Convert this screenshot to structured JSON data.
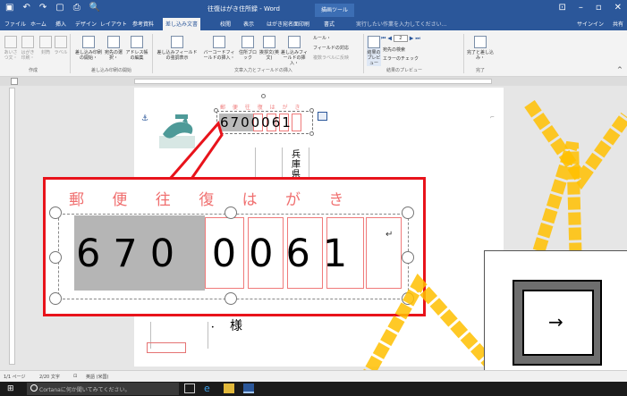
{
  "titlebar": {
    "save_icon": "save-icon",
    "undo_icon": "undo-icon",
    "redo_icon": "redo-icon",
    "new_icon": "new-document-icon",
    "print_preview_icon": "print-preview-icon",
    "title": "往復はがき住所録 - Word",
    "context_tab": "描画ツール",
    "minimize": "–",
    "maximize": "▫",
    "close": "✕",
    "restore": "⊡"
  },
  "tabs": {
    "items": [
      "ファイル",
      "ホーム",
      "挿入",
      "デザイン",
      "レイアウト",
      "参考資料",
      "差し込み文書",
      "校閲",
      "表示",
      "はがき宛名面印刷",
      "書式"
    ],
    "active_index": 6,
    "tell_me": "実行したい作業を入力してください...",
    "sign_in": "サインイン",
    "share": "共有"
  },
  "ribbon": {
    "create": {
      "group": "作成",
      "buttons": [
        "あいさつ文・",
        "はがき印刷・",
        "封筒",
        "ラベル"
      ]
    },
    "start": {
      "group": "差し込み印刷の開始",
      "buttons": [
        "差し込み印刷の開始・",
        "宛先の選択・",
        "アドレス帳の編集"
      ]
    },
    "fields": {
      "group": "文章入力とフィールドの挿入",
      "buttons": [
        "差し込みフィールドの強調表示",
        "バーコードフィールドの挿入・",
        "住所ブロック",
        "挨拶文(英文)",
        "差し込みフィールドの挿入・"
      ],
      "small": [
        "ルール・",
        "フィールドの対応",
        "複数ラベルに反映"
      ]
    },
    "preview": {
      "group": "結果のプレビュー",
      "button": "結果のプレビュー",
      "record": "2",
      "small": [
        "宛先の検索",
        "エラーのチェック"
      ]
    },
    "finish": {
      "group": "完了",
      "button": "完了と差し込み・"
    }
  },
  "document": {
    "zip_label": "郵 便 往 復 は が き",
    "zip_digits": "6700061",
    "address_vertical": "兵庫県",
    "sama": "様"
  },
  "callout": {
    "label": "郵 便 往 復 は が き",
    "digits": "670 0061"
  },
  "keycap": {
    "symbol": "→"
  },
  "status": {
    "page": "1/1 ページ",
    "words": "2/20 文字",
    "language": "英語 (米国)"
  },
  "taskbar": {
    "search_placeholder": "Cortanaに何か聞いてみてください。"
  },
  "colors": {
    "word_blue": "#2b579a",
    "callout_red": "#e8131b",
    "highlight_yellow": "#ffc000",
    "zip_pink": "#f07070"
  }
}
